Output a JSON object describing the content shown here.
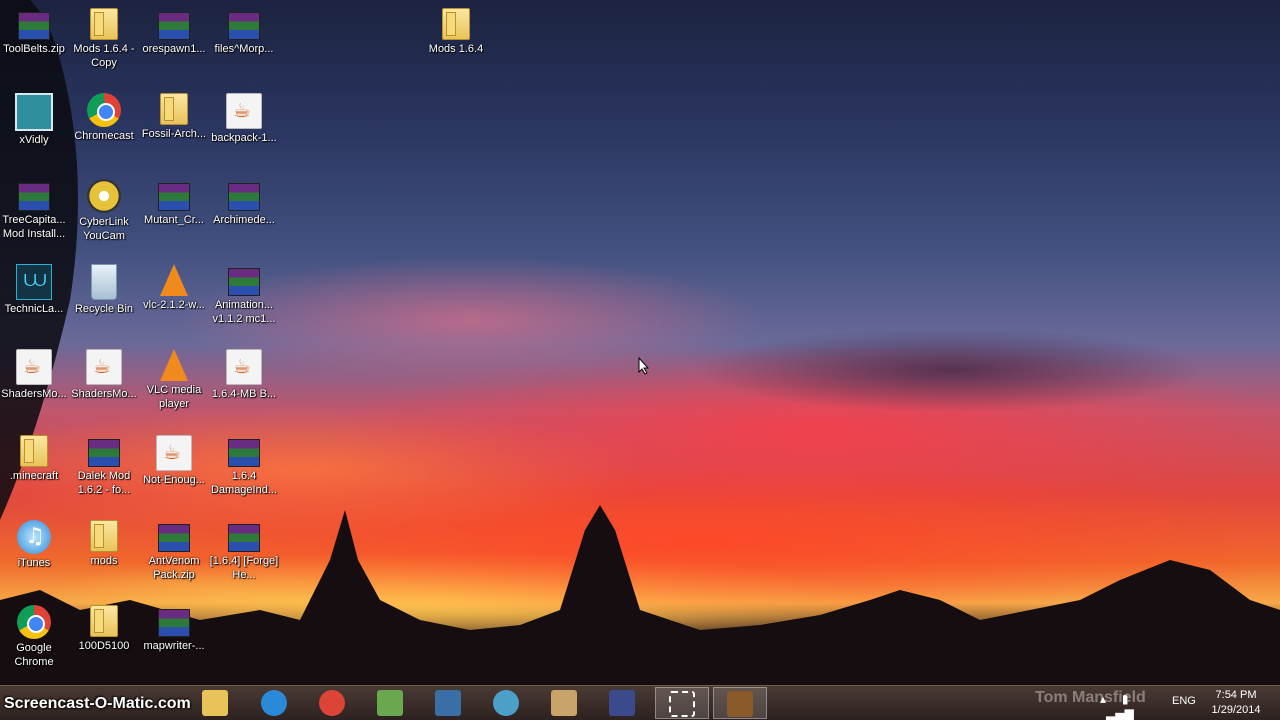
{
  "desktop": {
    "icons": [
      {
        "label": "ToolBelts.zip",
        "type": "rar"
      },
      {
        "label": "Mods 1.6.4 - Copy",
        "type": "folder"
      },
      {
        "label": "orespawn1...",
        "type": "rar"
      },
      {
        "label": "files^Morp...",
        "type": "rar"
      },
      {
        "label": "Mods 1.6.4",
        "type": "folder"
      },
      {
        "label": "xVidly",
        "type": "xvidly"
      },
      {
        "label": "Chromecast",
        "type": "chrome"
      },
      {
        "label": "Fossil-Arch...",
        "type": "folder"
      },
      {
        "label": "backpack-1...",
        "type": "java"
      },
      {
        "label": "TreeCapita... Mod Install...",
        "type": "rar"
      },
      {
        "label": "CyberLink YouCam",
        "type": "cyber"
      },
      {
        "label": "Mutant_Cr...",
        "type": "rar"
      },
      {
        "label": "Archimede...",
        "type": "rar"
      },
      {
        "label": "TechnicLa...",
        "type": "technic"
      },
      {
        "label": "Recycle Bin",
        "type": "recycle"
      },
      {
        "label": "vlc-2.1.2-w...",
        "type": "vlc"
      },
      {
        "label": "Animation... v1.1.2 mc1...",
        "type": "rar"
      },
      {
        "label": "ShadersMo...",
        "type": "java"
      },
      {
        "label": "ShadersMo...",
        "type": "java"
      },
      {
        "label": "VLC media player",
        "type": "vlc"
      },
      {
        "label": "1.6.4-MB B...",
        "type": "java"
      },
      {
        "label": ".minecraft",
        "type": "folder"
      },
      {
        "label": "Dalek Mod 1.6.2 - fo...",
        "type": "rar"
      },
      {
        "label": "Not-Enoug...",
        "type": "java"
      },
      {
        "label": "1.6.4 DamageInd...",
        "type": "rar"
      },
      {
        "label": "iTunes",
        "type": "itunes"
      },
      {
        "label": "mods",
        "type": "folder"
      },
      {
        "label": "AntVenom Pack.zip",
        "type": "rar"
      },
      {
        "label": "[1.6.4] [Forge] He...",
        "type": "rar"
      },
      {
        "label": "Google Chrome",
        "type": "chrome"
      },
      {
        "label": "100D5100",
        "type": "folder"
      },
      {
        "label": "mapwriter-...",
        "type": "rar"
      }
    ]
  },
  "taskbar": {
    "watermark": "Screencast-O-Matic.com",
    "pinned": [
      {
        "name": "file-explorer-icon"
      },
      {
        "name": "internet-explorer-icon"
      },
      {
        "name": "chrome-icon"
      },
      {
        "name": "minecraft-icon"
      },
      {
        "name": "remote-desktop-icon"
      },
      {
        "name": "network-globe-icon"
      },
      {
        "name": "word-app-icon"
      },
      {
        "name": "sun-app-icon"
      },
      {
        "name": "snipping-tool-icon"
      },
      {
        "name": "crafting-table-icon"
      }
    ],
    "author_text": "Tom Mansfield",
    "language": "ENG",
    "time": "7:54 PM",
    "date": "1/29/2014"
  }
}
